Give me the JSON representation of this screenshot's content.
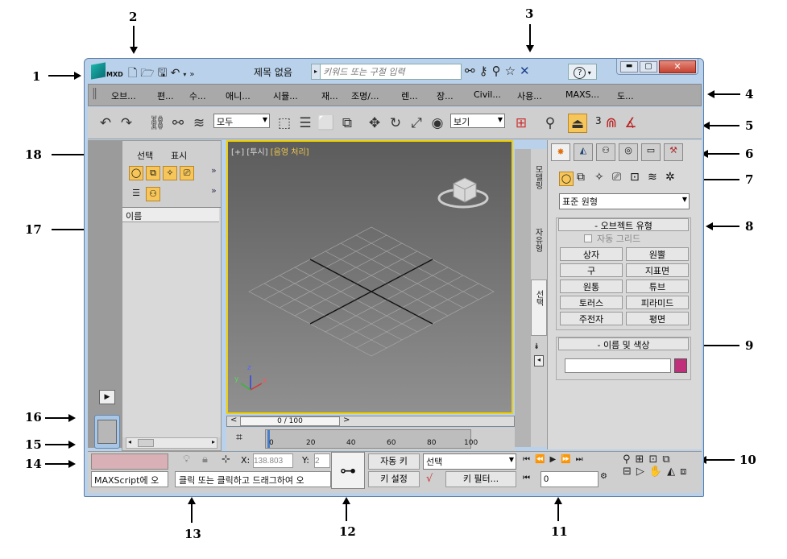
{
  "callouts": {
    "c1": "1",
    "c2": "2",
    "c3": "3",
    "c4": "4",
    "c5": "5",
    "c6": "6",
    "c7": "7",
    "c8": "8",
    "c9": "9",
    "c10": "10",
    "c11": "11",
    "c12": "12",
    "c13": "13",
    "c14": "14",
    "c15": "15",
    "c16": "16",
    "c17": "17",
    "c18": "18"
  },
  "titlebar": {
    "app_logo": "MXD",
    "title": "제목 없음",
    "search_placeholder": "키워드 또는 구절 입력",
    "help_label": "?"
  },
  "menu": [
    "오브...",
    "편...",
    "수...",
    "애니...",
    "시뮬...",
    "재...",
    "조명/...",
    "렌...",
    "장...",
    "Civil...",
    "사용...",
    "MAXS...",
    "도..."
  ],
  "toolbar": {
    "selection_filter": "모두",
    "coord_system": "보기",
    "snap_label": "3"
  },
  "scene_explorer": {
    "tab_select": "선택",
    "tab_display": "표시",
    "column_name": "이름",
    "expand": "»"
  },
  "viewport": {
    "label_plus": "[+]",
    "label_view": "[투시]",
    "label_shading": "[음영 처리]",
    "axis_x": "x",
    "axis_y": "y",
    "axis_z": "z"
  },
  "ribbon_tabs": [
    "모델링",
    "자유형",
    "선택"
  ],
  "command_panel": {
    "category_dropdown": "표준 원형",
    "rollout_object_type": "오브젝트 유형",
    "auto_grid": "자동 그리드",
    "buttons": [
      "상자",
      "원뿔",
      "구",
      "지표면",
      "원통",
      "튜브",
      "토러스",
      "피라미드",
      "주전자",
      "평면"
    ],
    "rollout_name_color": "이름 및 색상",
    "object_color": "#c0307a"
  },
  "timeline": {
    "slider_label": "0 / 100",
    "ticks": [
      "0",
      "20",
      "40",
      "60",
      "80",
      "100"
    ]
  },
  "status": {
    "maxscript_label": "MAXScript에 오",
    "prompt": "클릭 또는 클릭하고 드래그하여 오",
    "x_label": "X:",
    "x_value": "138.803",
    "y_label": "Y:",
    "y_value": "2"
  },
  "animation": {
    "auto_key": "자동 키",
    "set_key": "키 설정",
    "key_filter_select": "선택",
    "key_filters": "키 필터...",
    "frame_value": "0"
  }
}
